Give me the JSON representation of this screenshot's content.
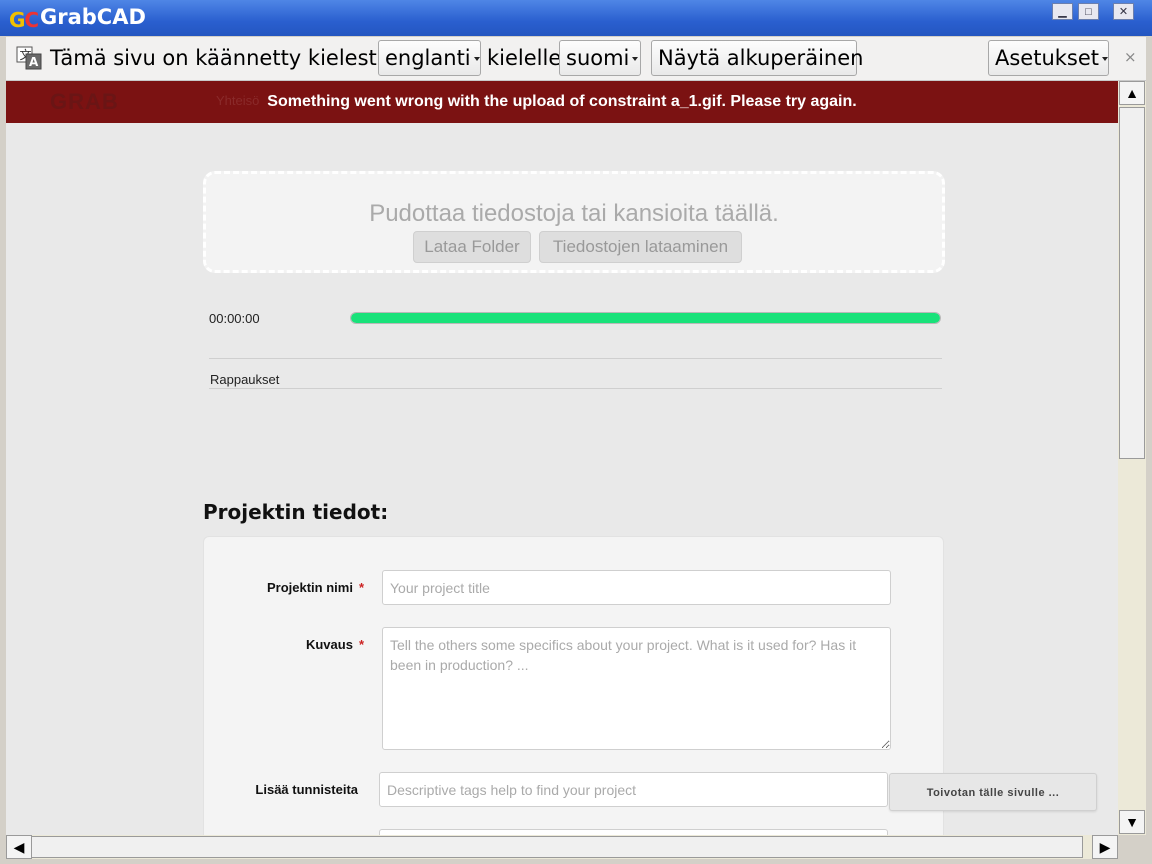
{
  "window": {
    "title": "GrabCAD",
    "logo_text": "GC",
    "minimize_icon": "minimize-icon",
    "maximize_icon": "maximize-icon",
    "close_icon": "close-icon"
  },
  "translate_bar": {
    "icon": "translate-icon",
    "prefix": "Tämä sivu on käännetty kielestä",
    "from_language": "englanti",
    "middle": "kielelle",
    "to_language": "suomi",
    "show_original_label": "Näytä alkuperäinen",
    "settings_label": "Asetukset",
    "close_label": "×"
  },
  "error_banner": {
    "background_color": "#7b1212",
    "message": "Something went wrong with the upload of constraint a_1.gif. Please try again.",
    "ghost_logo": "GRAB",
    "ghost_nav": "Yhteisö"
  },
  "upload": {
    "drop_text": "Pudottaa tiedostoja tai kansioita täällä.",
    "upload_folder_label": "Lataa Folder",
    "upload_files_label": "Tiedostojen lataaminen",
    "elapsed": "00:00:00",
    "progress": 1.0,
    "progress_color": "#19e27a",
    "crashes_label": "Rappaukset"
  },
  "project": {
    "section_title": "Projektin tiedot:",
    "name_label": "Projektin nimi",
    "name_placeholder": "Your project title",
    "description_label": "Kuvaus",
    "description_placeholder": "Tell the others some specifics about your project. What is it used for? Has it been in production? ...",
    "tags_label": "Lisää tunnisteita",
    "tags_placeholder": "Descriptive tags help to find your project",
    "required_mark": "*"
  },
  "suggest_button": {
    "label": "Toivotan tälle sivulle ..."
  },
  "scrollbars": {
    "up_arrow": "▲",
    "down_arrow": "▼",
    "left_arrow": "◀",
    "right_arrow": "▶"
  }
}
